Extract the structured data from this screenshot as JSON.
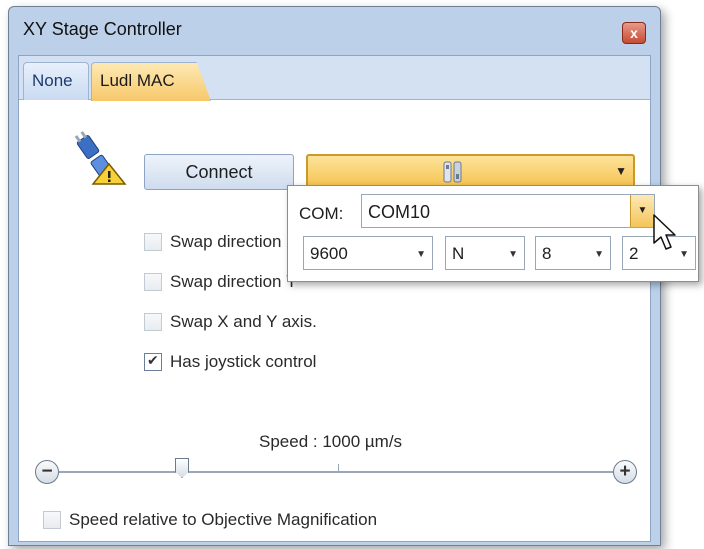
{
  "window": {
    "title": "XY Stage Controller",
    "close_glyph": "x"
  },
  "tabs": [
    {
      "label": "None",
      "active": false
    },
    {
      "label": "Ludl MAC",
      "active": true
    }
  ],
  "connection": {
    "icon": "plug-warning-icon",
    "connect_label": "Connect",
    "port_icon": "tools-icon"
  },
  "options": [
    {
      "label": "Swap direction X",
      "checked": false
    },
    {
      "label": "Swap direction Y",
      "checked": false
    },
    {
      "label": "Swap X and Y axis.",
      "checked": false
    },
    {
      "label": "Has joystick control",
      "checked": true
    }
  ],
  "speed": {
    "label": "Speed : 1000 µm/s",
    "minus": "−",
    "plus": "+"
  },
  "speed_relative": {
    "label": "Speed relative to Objective Magnification",
    "checked": false
  },
  "popup": {
    "com_label": "COM:",
    "com_value": "COM10",
    "baud": "9600",
    "parity": "N",
    "data_bits": "8",
    "stop_bits": "2"
  }
}
